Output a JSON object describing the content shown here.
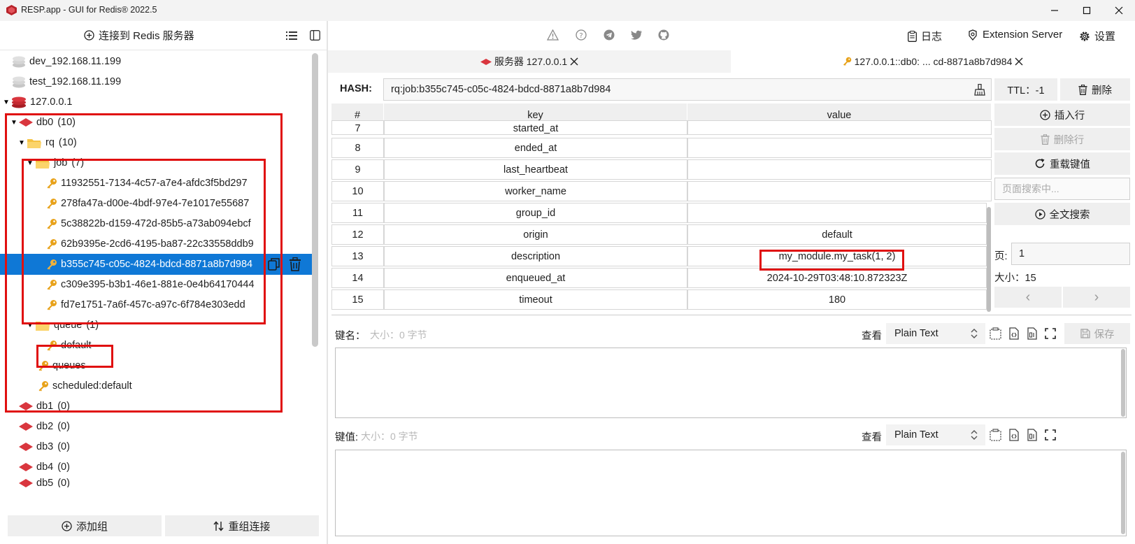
{
  "window": {
    "title": "RESP.app - GUI for Redis® 2022.5"
  },
  "left_toolbar": {
    "connect_label": "连接到 Redis 服务器"
  },
  "right_toolbar": {
    "log_label": "日志",
    "extension_label": "Extension Server",
    "settings_label": "设置"
  },
  "tree": {
    "connections": [
      {
        "label": "dev_192.168.11.199"
      },
      {
        "label": "test_192.168.11.199"
      },
      {
        "label": "127.0.0.1"
      }
    ],
    "db0": {
      "label": "db0",
      "count": "(10)"
    },
    "rq": {
      "label": "rq",
      "count": "(10)"
    },
    "job": {
      "label": "job",
      "count": "(7)"
    },
    "job_keys": [
      "11932551-7134-4c57-a7e4-afdc3f5bd297",
      "278fa47a-d00e-4bdf-97e4-7e1017e55687",
      "5c38822b-d159-472d-85b5-a73ab094ebcf",
      "62b9395e-2cd6-4195-ba87-22c33558ddb9",
      "b355c745-c05c-4824-bdcd-8871a8b7d984",
      "c309e395-b3b1-46e1-881e-0e4b64170444",
      "fd7e1751-7a6f-457c-a97c-6f784e303edd"
    ],
    "queue": {
      "label": "queue",
      "count": "(1)"
    },
    "queue_keys": [
      "default"
    ],
    "rq_keys": [
      "queues",
      "scheduled:default"
    ],
    "other_dbs": [
      {
        "label": "db1",
        "count": "(0)"
      },
      {
        "label": "db2",
        "count": "(0)"
      },
      {
        "label": "db3",
        "count": "(0)"
      },
      {
        "label": "db4",
        "count": "(0)"
      },
      {
        "label": "db5",
        "count": "(0)"
      }
    ]
  },
  "left_bottom": {
    "add_group": "添加组",
    "regroup": "重组连接"
  },
  "tabs": [
    {
      "label": "服务器 127.0.0.1"
    },
    {
      "label": "127.0.0.1::db0: ... cd-8871a8b7d984"
    }
  ],
  "key_view": {
    "type_label": "HASH:",
    "key_name": "rq:job:b355c745-c05c-4824-bdcd-8871a8b7d984",
    "ttl_label": "TTL：-1",
    "delete_label": "删除",
    "insert_row": "插入行",
    "delete_row": "删除行",
    "reload": "重载键值",
    "page_search_placeholder": "页面搜索中...",
    "fulltext_search": "全文搜索",
    "page_label": "页:",
    "page_value": "1",
    "size_label": "大小：15",
    "prev": "‹",
    "next": "›"
  },
  "table": {
    "headers": [
      "#",
      "key",
      "value"
    ],
    "rows": [
      {
        "n": "7",
        "key": "started_at",
        "value": ""
      },
      {
        "n": "8",
        "key": "ended_at",
        "value": ""
      },
      {
        "n": "9",
        "key": "last_heartbeat",
        "value": ""
      },
      {
        "n": "10",
        "key": "worker_name",
        "value": ""
      },
      {
        "n": "11",
        "key": "group_id",
        "value": ""
      },
      {
        "n": "12",
        "key": "origin",
        "value": "default"
      },
      {
        "n": "13",
        "key": "description",
        "value": "my_module.my_task(1, 2)"
      },
      {
        "n": "14",
        "key": "enqueued_at",
        "value": "2024-10-29T03:48:10.872323Z"
      },
      {
        "n": "15",
        "key": "timeout",
        "value": "180"
      }
    ]
  },
  "editor": {
    "key_name_label": "键名：",
    "key_name_size": "大小：0 字节",
    "key_value_label": "键值:",
    "key_value_size": "大小：0 字节",
    "view_label": "查看",
    "format": "Plain Text",
    "save_label": "保存"
  },
  "colors": {
    "selected_row": "#0f78d6",
    "highlight_box": "#e01010",
    "redis_red": "#d9363e",
    "key_orange": "#e8a21a",
    "folder_yellow": "#f5c242"
  }
}
